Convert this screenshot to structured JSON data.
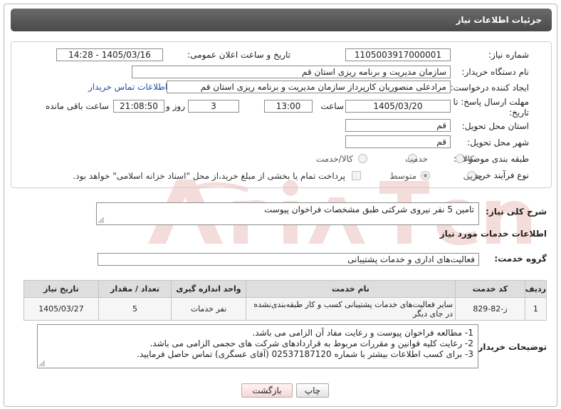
{
  "header": {
    "title": "جزئیات اطلاعات نیاز"
  },
  "form": {
    "need_number_label": "شماره نیاز:",
    "need_number": "1105003917000001",
    "announce_label": "تاریخ و ساعت اعلان عمومی:",
    "announce_value": "1405/03/16 - 14:28",
    "buyer_org_label": "نام دستگاه خریدار:",
    "buyer_org": "سازمان مدیریت و برنامه ریزی استان قم",
    "requester_label": "ایجاد کننده درخواست:",
    "requester": "مرادعلی منصوریان کارپرداز سازمان مدیریت و برنامه ریزی استان قم",
    "contact_link": "اطلاعات تماس خریدار",
    "deadline_label": "مهلت ارسال پاسخ: تا تاریخ:",
    "deadline_date": "1405/03/20",
    "time_label": "ساعت",
    "deadline_time": "13:00",
    "days_value": "3",
    "days_label": "روز و",
    "remaining_time": "21:08:50",
    "remaining_label": "ساعت باقی مانده",
    "province_label": "استان محل تحویل:",
    "province": "قم",
    "city_label": "شهر محل تحویل:",
    "city": "قم",
    "category_label": "طبقه بندی موضوعی:",
    "category_options": [
      "کالا",
      "خدمت",
      "کالا/خدمت"
    ],
    "category_selected": "",
    "process_label": "نوع فرآیند خرید :",
    "process_options": [
      "جزیی",
      "متوسط"
    ],
    "process_selected": "متوسط",
    "payment_note": "پرداخت تمام یا بخشی از مبلغ خرید،از محل \"اسناد خزانه اسلامی\" خواهد بود."
  },
  "summary": {
    "label": "شرح کلی نیاز:",
    "text": "تامین 5 نفر نیروی شرکتی طبق مشخصات فراخوان پیوست"
  },
  "services": {
    "section_title": "اطلاعات خدمات مورد نیاز",
    "group_label": "گروه خدمت:",
    "group_value": "فعالیت‌های اداری و خدمات پشتیبانی",
    "columns": [
      "ردیف",
      "کد خدمت",
      "نام خدمت",
      "واحد اندازه گیری",
      "تعداد / مقدار",
      "تاریخ نیاز"
    ],
    "rows": [
      {
        "row": "1",
        "code": "ز-82-829",
        "name": "سایر فعالیت‌های خدمات پشتیبانی کسب و کار طبقه‌بندی‌نشده در جای دیگر",
        "unit": "نفر خدمات",
        "qty": "5",
        "date": "1405/03/27"
      }
    ]
  },
  "buyer_notes": {
    "label": "توضیحات خریدار:",
    "lines": [
      "1- مطالعه فراخوان پیوست و رعایت مفاد آن الزامی می باشد.",
      "2- رعایت کلیه قوانین و مقررات مربوط به قراردادهای شرکت های حجمی الزامی می باشد.",
      "3- برای کسب اطلاعات بیشتر با شماره 02537187120 (آقای عسگری) تماس حاصل فرمایید."
    ]
  },
  "buttons": {
    "print": "چاپ",
    "back": "بازگشت"
  },
  "colors": {
    "header_bg": "#555555",
    "link": "#1a4fa8",
    "watermark": "#c0392b"
  }
}
